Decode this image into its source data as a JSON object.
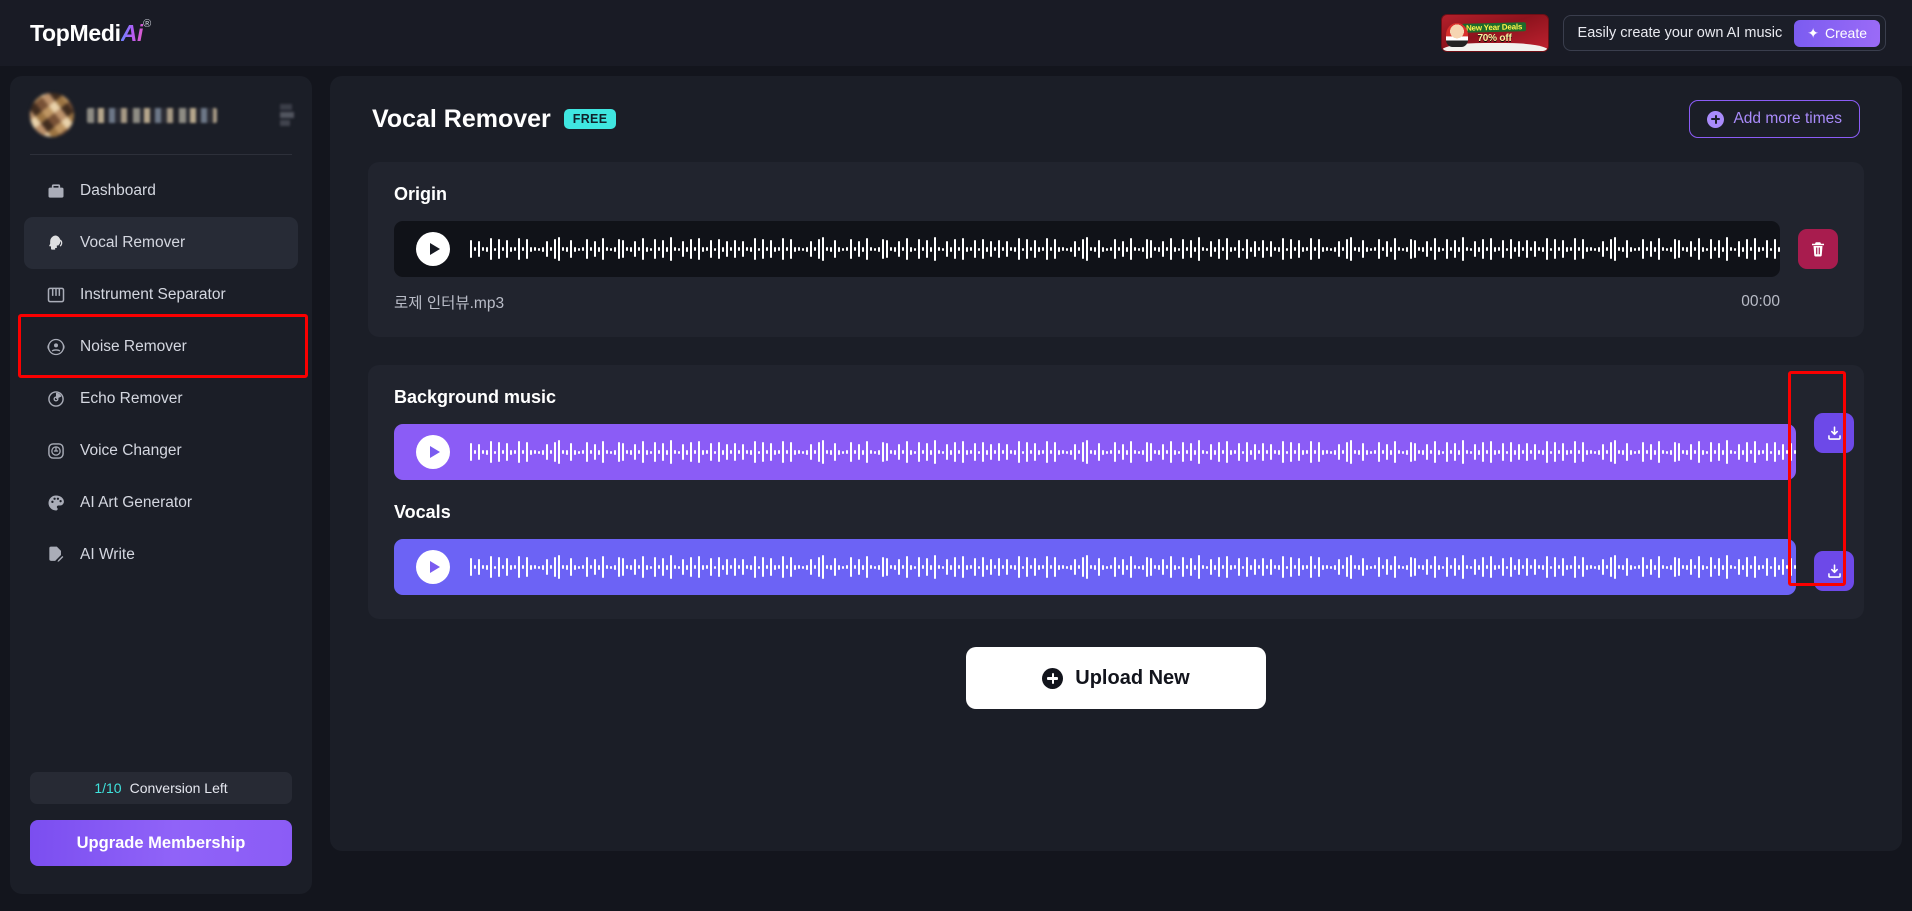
{
  "header": {
    "logo_main": "TopMedi",
    "logo_ai": "Ai",
    "logo_reg": "®",
    "promo": {
      "line1": "New Year Deals",
      "line2": "70% off"
    },
    "cta_text": "Easily create your own AI music",
    "create_label": "Create",
    "create_icon": "sparkle-icon"
  },
  "sidebar": {
    "profile": {
      "avatar": "user-avatar-blurred",
      "username": "blurred-username",
      "menu_icon": "more-options-icon"
    },
    "items": [
      {
        "label": "Dashboard",
        "icon": "briefcase-icon",
        "active": false
      },
      {
        "label": "Vocal Remover",
        "icon": "head-voice-icon",
        "active": true
      },
      {
        "label": "Instrument Separator",
        "icon": "piano-keys-icon",
        "active": false
      },
      {
        "label": "Noise Remover",
        "icon": "noise-waves-icon",
        "active": false
      },
      {
        "label": "Echo Remover",
        "icon": "echo-circle-icon",
        "active": false
      },
      {
        "label": "Voice Changer",
        "icon": "voice-dial-icon",
        "active": false
      },
      {
        "label": "AI Art Generator",
        "icon": "palette-icon",
        "active": false
      },
      {
        "label": "AI Write",
        "icon": "document-pen-icon",
        "active": false
      }
    ],
    "conversion": {
      "count": "1/10",
      "label": "Conversion Left"
    },
    "upgrade_label": "Upgrade Membership"
  },
  "main": {
    "title": "Vocal Remover",
    "badge": "FREE",
    "add_more_label": "Add more times",
    "origin": {
      "label": "Origin",
      "filename": "로제 인터뷰.mp3",
      "duration": "00:00",
      "play_icon": "play-icon",
      "delete_icon": "trash-icon"
    },
    "background_music": {
      "label": "Background music",
      "play_icon": "play-icon",
      "download_icon": "download-icon"
    },
    "vocals": {
      "label": "Vocals",
      "play_icon": "play-icon",
      "download_icon": "download-icon"
    },
    "upload_label": "Upload New",
    "upload_icon": "plus-circle-icon"
  },
  "colors": {
    "accent_purple": "#8b5cf6",
    "vocals_purple": "#6c63f5",
    "free_badge": "#3fe6e0",
    "delete_red": "#a81c4e",
    "highlight_box": "#fa0000",
    "conversion_teal": "#3fe3dd"
  }
}
